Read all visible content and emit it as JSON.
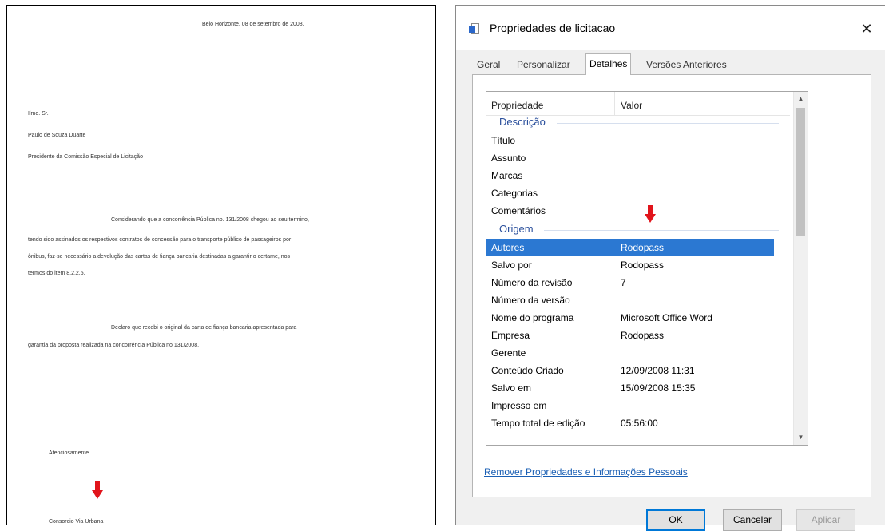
{
  "document": {
    "date_line": "Belo Horizonte, 08 de setembro de 2008.",
    "salutation": "Ilmo. Sr.",
    "recipient_name": "Paulo de Souza Duarte",
    "recipient_title": "Presidente da Comissão Especial de Licitação",
    "paragraph1_line1": "Considerando que a concorrência Pública no. 131/2008 chegou ao seu termino,",
    "paragraph1_line2": "tendo sido assinados os respectivos contratos de concessão para o transporte público de passageiros por",
    "paragraph1_line3": "ônibus, faz-se necessário a devolução das cartas de fiança bancaria destinadas a garantir o certame, nos",
    "paragraph1_line4": "termos do item 8.2.2.5.",
    "paragraph2_line1": "Declaro que recebi o original da carta de fiança bancaria apresentada para",
    "paragraph2_line2": "garantia da proposta realizada na concorrência Pública no 131/2008.",
    "closing": "Atenciosamente.",
    "signature": "Consorcio Via Urbana"
  },
  "dialog": {
    "title": "Propriedades de licitacao",
    "tabs": [
      {
        "label": "Geral"
      },
      {
        "label": "Personalizar"
      },
      {
        "label": "Detalhes"
      },
      {
        "label": "Versões Anteriores"
      }
    ],
    "columns": {
      "property": "Propriedade",
      "value": "Valor"
    },
    "groups": {
      "description": "Descrição",
      "origin": "Origem"
    },
    "description_rows": [
      {
        "key": "Título",
        "value": ""
      },
      {
        "key": "Assunto",
        "value": ""
      },
      {
        "key": "Marcas",
        "value": ""
      },
      {
        "key": "Categorias",
        "value": ""
      },
      {
        "key": "Comentários",
        "value": ""
      }
    ],
    "origin_rows": [
      {
        "key": "Autores",
        "value": "Rodopass"
      },
      {
        "key": "Salvo por",
        "value": "Rodopass"
      },
      {
        "key": "Número da revisão",
        "value": "7"
      },
      {
        "key": "Número da versão",
        "value": ""
      },
      {
        "key": "Nome do programa",
        "value": "Microsoft Office Word"
      },
      {
        "key": "Empresa",
        "value": "Rodopass"
      },
      {
        "key": "Gerente",
        "value": ""
      },
      {
        "key": "Conteúdo Criado",
        "value": "12/09/2008 11:31"
      },
      {
        "key": "Salvo em",
        "value": "15/09/2008 15:35"
      },
      {
        "key": "Impresso em",
        "value": ""
      },
      {
        "key": "Tempo total de edição",
        "value": "05:56:00"
      }
    ],
    "remove_link": "Remover Propriedades e Informações Pessoais",
    "buttons": {
      "ok": "OK",
      "cancel": "Cancelar",
      "apply": "Aplicar"
    },
    "close_glyph": "✕",
    "scroll_up_glyph": "▲",
    "scroll_down_glyph": "▼"
  },
  "colors": {
    "arrow": "#e1141b",
    "selection": "#2b78d2",
    "link": "#1a5fb4",
    "group_header": "#2a4f9c"
  }
}
